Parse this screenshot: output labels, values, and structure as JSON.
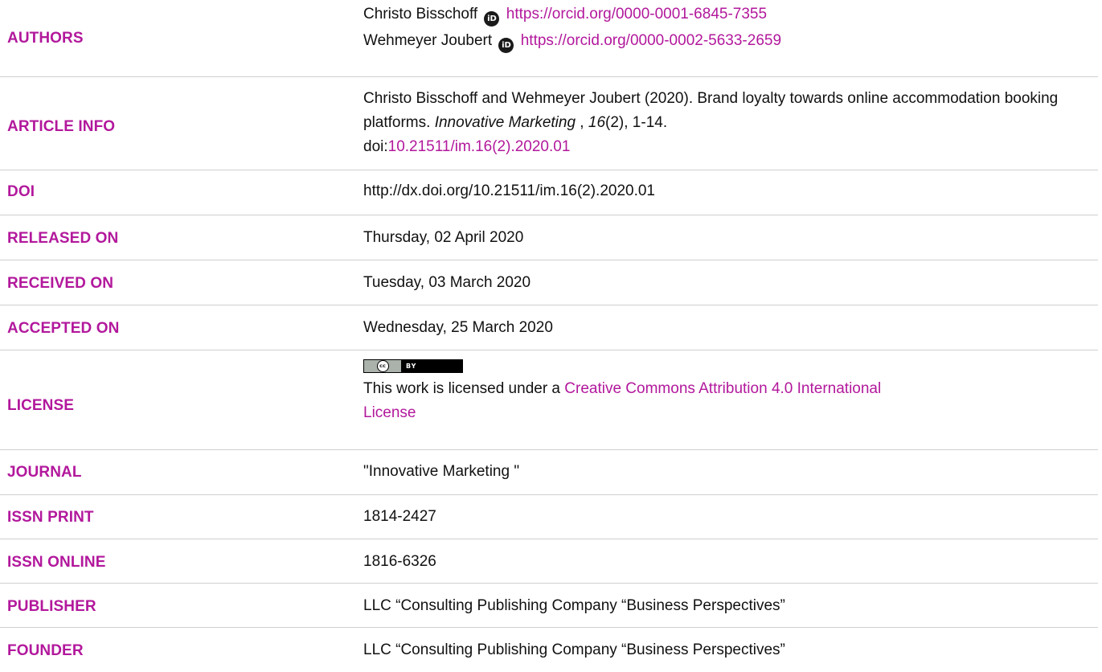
{
  "authors": {
    "label": "AUTHORS",
    "items": [
      {
        "name": "Christo Bisschoff",
        "orcid_url": "https://orcid.org/0000-0001-6845-7355"
      },
      {
        "name": "Wehmeyer Joubert",
        "orcid_url": "https://orcid.org/0000-0002-5633-2659"
      }
    ]
  },
  "article_info": {
    "label": "ARTICLE INFO",
    "citation_prefix": "Christo Bisschoff and Wehmeyer Joubert (2020). Brand loyalty towards online accommodation booking platforms. ",
    "journal_italic": "Innovative Marketing",
    "sep": " , ",
    "volume_italic": "16",
    "issue_pages": "(2), 1-14.",
    "doi_prefix": "doi:",
    "doi_link": "10.21511/im.16(2).2020.01"
  },
  "doi": {
    "label": "DOI",
    "value": "http://dx.doi.org/10.21511/im.16(2).2020.01"
  },
  "released_on": {
    "label": "RELEASED ON",
    "value": "Thursday, 02 April 2020"
  },
  "received_on": {
    "label": "RECEIVED ON",
    "value": "Tuesday, 03 March 2020"
  },
  "accepted_on": {
    "label": "ACCEPTED ON",
    "value": "Wednesday, 25 March 2020"
  },
  "license": {
    "label": "LICENSE",
    "badge_cc": "cc",
    "badge_by": "BY",
    "text_prefix": "This work is licensed under a ",
    "link_line1": "Creative Commons Attribution 4.0 International",
    "link_line2": "License"
  },
  "journal": {
    "label": "JOURNAL",
    "value": "\"Innovative Marketing \""
  },
  "issn_print": {
    "label": "ISSN PRINT",
    "value": "1814-2427"
  },
  "issn_online": {
    "label": "ISSN ONLINE",
    "value": "1816-6326"
  },
  "publisher": {
    "label": "PUBLISHER",
    "value": "LLC “Consulting Publishing Company “Business Perspectives”"
  },
  "founder": {
    "label": "FOUNDER",
    "value": "LLC “Consulting Publishing Company “Business Perspectives”"
  },
  "icons": {
    "orcid": "orcid-icon",
    "cc_badge": "cc-by-license-badge"
  },
  "colors": {
    "label": "#b2189c",
    "link": "#b2189c",
    "text": "#111111",
    "divider": "#cfcfcf"
  }
}
